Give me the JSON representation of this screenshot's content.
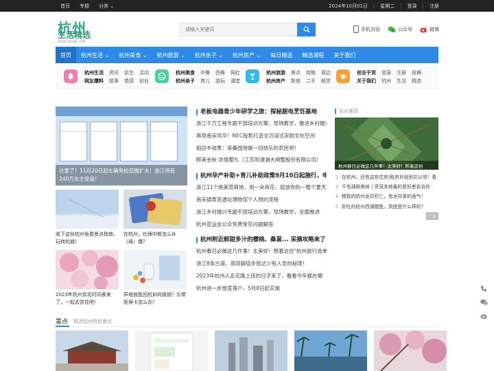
{
  "topbar": {
    "links": [
      "首页",
      "专题",
      "分类"
    ],
    "date": "2024年10月01日",
    "weekday": "星期二",
    "login": "登录",
    "register": "注册"
  },
  "logo": {
    "mark": "杭州",
    "name": "生活精选",
    "domain": "HZJINGXUAN.COM"
  },
  "search": {
    "placeholder": "请输入关键词"
  },
  "header_links": {
    "mobile": "手机浏览",
    "wechat_account": "公众号",
    "weibo": "微博"
  },
  "nav": [
    "首页",
    "杭州生活",
    "杭州美食",
    "杭州旅游",
    "杭州亲子",
    "杭州房产",
    "每日精选",
    "精选课程",
    "关于我们"
  ],
  "categories": [
    {
      "r1": [
        "杭州生活",
        "资讯",
        "民生",
        "活动"
      ],
      "r2": [
        "网友爆料",
        "故事",
        "情感",
        "创业"
      ],
      "color": "#f07ea8",
      "icon": "bell-icon"
    },
    {
      "r1": [
        "杭州美食",
        "中餐",
        "西餐",
        "网红"
      ],
      "r2": [
        "杭州亲子",
        "育儿",
        "游玩",
        "课堂"
      ],
      "color": "#4ccf9f",
      "icon": "smile-icon"
    },
    {
      "r1": [
        "杭州旅游",
        "景点",
        "攻略",
        "周边"
      ],
      "r2": [
        "杭州房产",
        "新盘",
        "二手",
        "租赁"
      ],
      "color": "#33b9e8",
      "icon": "cocktail-icon"
    },
    {
      "r1": [
        "创业干货",
        "登录",
        "注册",
        "投稿"
      ],
      "r2": [
        "关于我们",
        "杭州",
        "生活",
        "精选"
      ],
      "color": "#f6a23b",
      "icon": "cup-icon"
    }
  ],
  "featured": {
    "caption": "注意了！11月20日起车辆免检范围扩大！浙江将有240万车主受益！",
    "cards": [
      "注册登记日期",
      "免于上线检验情形",
      "需要到检验机构上线检验的情形",
      "提示事项"
    ]
  },
  "thumbs": [
    {
      "title": "收下这份杭州免费景点指南，玩转杭城！"
    },
    {
      "title": "在杭州，社保中断怎么补（续）缴？"
    },
    {
      "title": "2023年杭州赏花时间表来了，一起去赏花吧！"
    },
    {
      "title": "异地就医回杭如何报销？忘带医保卡怎么办？"
    }
  ],
  "middle": [
    {
      "title": "老板电器青少年研学之旅：探秘厨电烹饪基地",
      "items": [
        "浙江千万工程专题干部培训方案，现场教学，推进乡村振兴",
        "再现南宋风华！NEC投影打造全沉浸式宋韵文化空间",
        "稻田丰收季：来桑园地做一回快乐的农民吧！",
        "醉美金秋·浓情蟹礼（江苏阳澄湖大闸蟹股份有限公司）"
      ]
    },
    {
      "title": "杭州孕产补助+育儿补助政策9月10日起施行，申领指南",
      "items": [
        "浙江11个绝美赏荷地，用一朵荷花，绽放你的一整个夏天",
        "南宋德寿宫遗址博物馆个人预约流程",
        "浙江乡村振兴专题干部培训方案，现场教学，全面推进",
        "杭州亚运会公众免费常见问题解答"
      ]
    },
    {
      "title": "杭州附近鲜甜多汁的樱桃、桑葚... 采摘攻略来了",
      "items": [
        "杭州春日必做这几件事！太美好！照着这份\"杭州旅行清单\"",
        "浙江8条古道，用双脚徒步抵达少有人至的秘境！",
        "2023年杭州人走花路上班的日子来了，看看今年都在哪",
        "杭州进一步放宽落户，5月8日起实施"
      ]
    }
  ],
  "side": {
    "header": "站长推荐",
    "pic_caption": "杭州春日必做这几件事！太美好！照着这份",
    "list": [
      {
        "n": "2",
        "t": "在杭州，还有这些住房|租房补贴别忘以领！看"
      },
      {
        "n": "3",
        "t": "千岛湖鲜美味 | 资深本地番的爱好者告诉你"
      },
      {
        "n": "4",
        "t": "精致的杭州龙井虾仁，有龙井茶的香气！"
      },
      {
        "n": "5",
        "t": "好吃的杭州西湖醋鱼，到底是什么样的？"
      }
    ],
    "ad_label": "广告"
  },
  "scenic": {
    "title": "景点",
    "subtitle": "精选杭州特色景点"
  }
}
